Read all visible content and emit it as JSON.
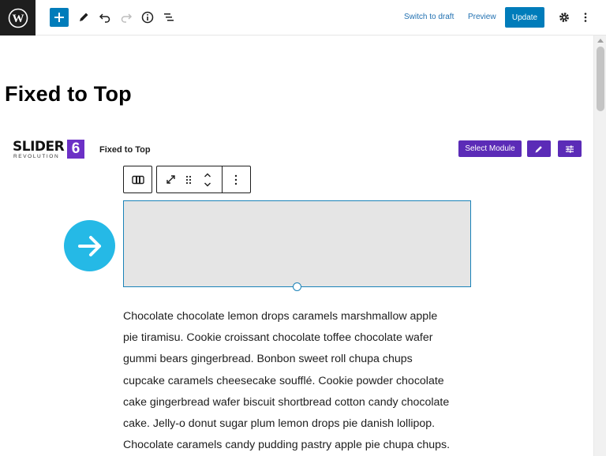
{
  "toolbar": {
    "switch_to_draft": "Switch to draft",
    "preview": "Preview",
    "update": "Update",
    "icons": [
      "wordpress-logo",
      "add-block-icon",
      "tools-pencil-icon",
      "undo-icon",
      "redo-icon",
      "info-icon",
      "list-view-icon",
      "settings-gear-icon",
      "more-options-icon"
    ]
  },
  "page": {
    "title": "Fixed to Top"
  },
  "slider_block": {
    "logo_word": "SLIDER",
    "logo_sub": "REVOLUTION",
    "logo_number": "6",
    "module_title": "Fixed to Top",
    "select_module": "Select Module",
    "accent_color": "#5b2bb7"
  },
  "content": {
    "paragraph_lines": [
      "Chocolate chocolate lemon drops caramels marshmallow apple",
      "pie tiramisu. Cookie croissant chocolate toffee chocolate wafer",
      "gummi bears gingerbread. Bonbon sweet roll chupa chups",
      "cupcake caramels cheesecake soufflé. Cookie powder chocolate",
      "cake gingerbread wafer biscuit shortbread cotton candy chocolate",
      "cake. Jelly-o donut sugar plum lemon drops pie danish lollipop.",
      "Chocolate caramels candy pudding pastry apple pie chupa chups."
    ]
  },
  "colors": {
    "primary": "#007cba",
    "arrow_circle": "#25b9e6",
    "selection_border": "#1a82b8"
  }
}
